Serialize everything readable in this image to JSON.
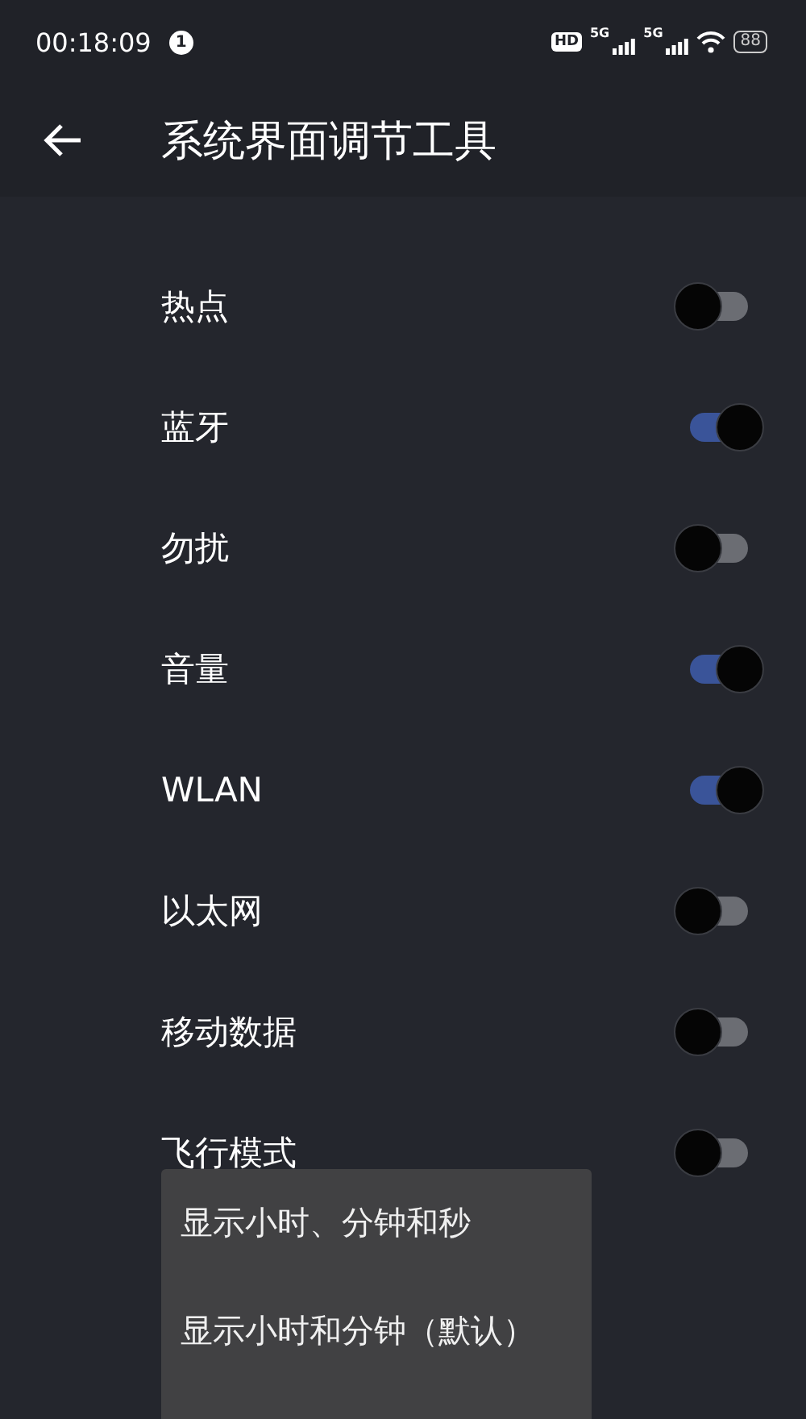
{
  "status_bar": {
    "time": "00:18:09",
    "notification_count": "1",
    "hd": "HD",
    "networks": [
      "5G",
      "5G"
    ],
    "battery": "88"
  },
  "toolbar": {
    "title": "系统界面调节工具"
  },
  "items": [
    {
      "label": "热点",
      "on": false
    },
    {
      "label": "蓝牙",
      "on": true
    },
    {
      "label": "勿扰",
      "on": false
    },
    {
      "label": "音量",
      "on": true
    },
    {
      "label": "WLAN",
      "on": true
    },
    {
      "label": "以太网",
      "on": false
    },
    {
      "label": "移动数据",
      "on": false
    },
    {
      "label": "飞行模式",
      "on": false
    }
  ],
  "popup_menu": {
    "options": [
      "显示小时、分钟和秒",
      "显示小时和分钟（默认）"
    ]
  }
}
